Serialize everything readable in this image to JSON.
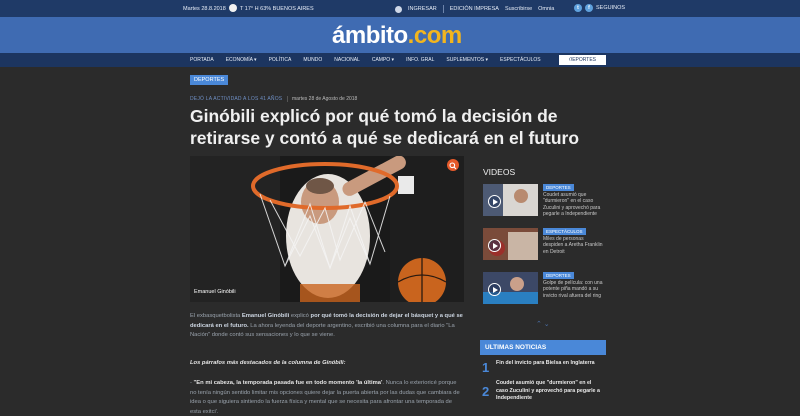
{
  "topbar": {
    "date": "Martes 28.8.2018",
    "weather": "T 17° H 63%   BUENOS AIRES",
    "login": "INGRESAR",
    "edition": "EDICIÓN IMPRESA",
    "subscribe": "Suscribirse",
    "omnia": "Omnia",
    "follow": "SEGUINOS"
  },
  "logo": {
    "main": "ámbito",
    "suffix": ".com"
  },
  "nav": {
    "items": [
      "PORTADA",
      "ECONOMÍA ▾",
      "POLÍTICA",
      "MUNDO",
      "NACIONAL",
      "CAMPO ▾",
      "INFO. GRAL",
      "SUPLEMENTOS ▾",
      "ESPECTÁCULOS",
      "DEPORTES"
    ]
  },
  "article": {
    "section": "DEPORTES",
    "kicker": "DEJÓ LA ACTIVIDAD A LOS 41 AÑOS",
    "date": "martes 28 de Agosto de 2018",
    "headline": "Ginóbili explicó por qué tomó la decisión de retirarse y contó a qué se dedicará en el futuro",
    "photo_caption": "Emanuel Ginóbili",
    "p1_a": "El exbasquetbolista ",
    "p1_name": "Emanuel Ginóbili",
    "p1_b": " explicó ",
    "p1_bold": "por qué tomó la decisión de dejar el básquet y a qué se dedicará en el futuro.",
    "p1_c": " La ahora leyenda del deporte argentino, escribió una columna para el diario \"La Nación\" donde contó sus sensaciones y lo que se viene.",
    "p2": "Los párrafos más destacados de la columna de Ginóbili:",
    "p3_quote": "\"En mi cabeza, la temporada pasada fue en todo momento 'la última'",
    "p3_a": "- ",
    "p3_b": ". Nunca lo exterioricé porque no tenía ningún sentido limitar mis opciones quiere dejar la puerta abierta por las dudas que cambiara de idea o que siguiera sintiendo la fuerza física y mental que se necesita para afrontar una temporada de esta exitci'."
  },
  "videos": {
    "title": "VIDEOS",
    "items": [
      {
        "tag": "DEPORTES",
        "desc": "Coudet asumió que \"durmieron\" en el caso Zuculini y aprovechó para pegarle a Independiente"
      },
      {
        "tag": "ESPECTÁCULOS",
        "desc": "Miles de personas despiden a Aretha Franklin en Detroit"
      },
      {
        "tag": "DEPORTES",
        "desc": "Golpe de película: con una potente piña mandó a su invicto rival afuera del ring"
      }
    ]
  },
  "latest": {
    "title": "ULTIMAS NOTICIAS",
    "items": [
      {
        "num": "1",
        "text": "Fin del invicto para Bielsa en Inglaterra"
      },
      {
        "num": "2",
        "text": "Coudet asumió que \"durmieron\" en el caso Zuculini y aprovechó para pegarle a Independiente"
      }
    ]
  },
  "colors": {
    "brand": "#3f6bb2",
    "nav": "#1c3560",
    "accent": "#4a88d8",
    "logo_dot": "#f2b51e"
  }
}
